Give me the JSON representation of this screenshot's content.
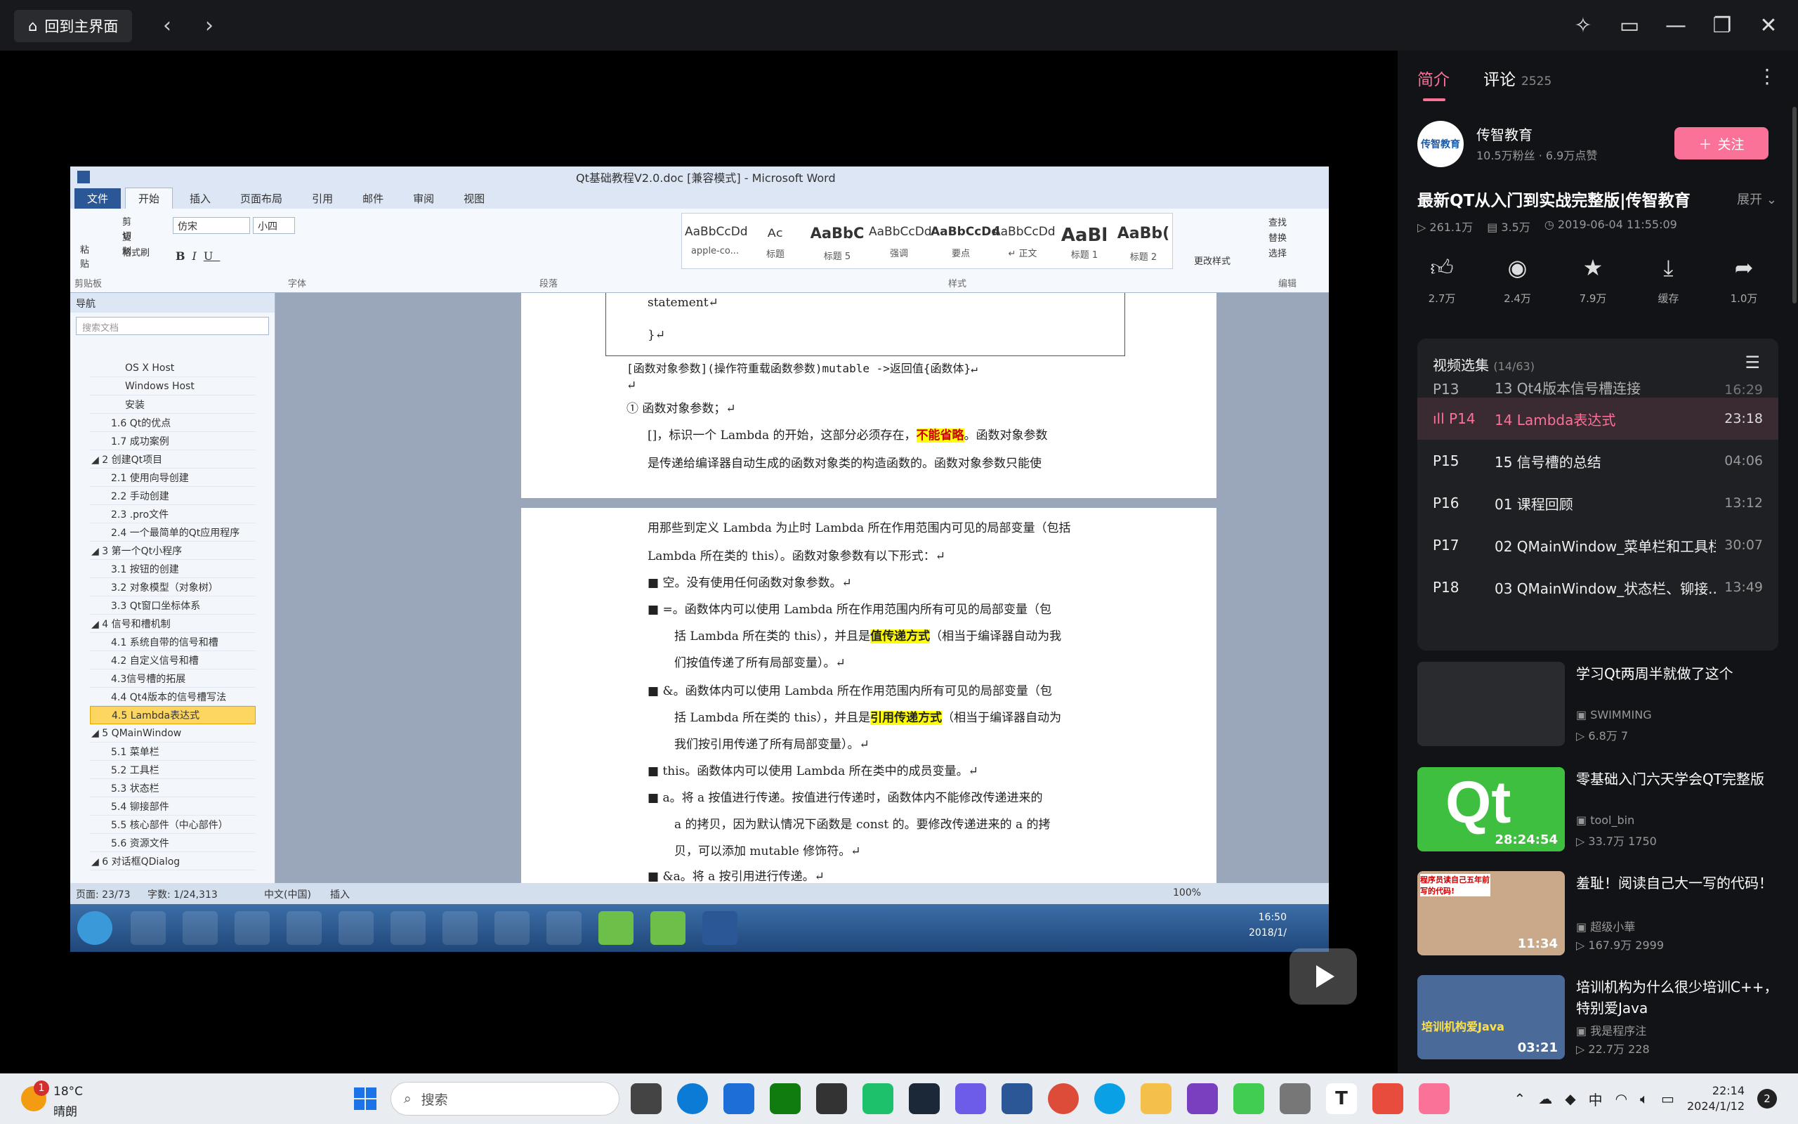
{
  "topbar": {
    "home_label": "回到主界面",
    "back_icon": "chevron-left-icon",
    "forward_icon": "chevron-right-icon"
  },
  "video": {
    "word": {
      "window_title": "Qt基础教程V2.0.doc [兼容模式] - Microsoft Word",
      "tabs": [
        "文件",
        "开始",
        "插入",
        "页面布局",
        "引用",
        "邮件",
        "审阅",
        "视图"
      ],
      "font_name": "仿宋",
      "font_size": "小四",
      "groups": [
        "剪贴板",
        "字体",
        "段落",
        "样式",
        "编辑"
      ],
      "styles": [
        {
          "sample": "AaBbCcDd",
          "label": "apple-co..."
        },
        {
          "sample": "ᴬᶜ",
          "label": "标题"
        },
        {
          "sample": "AaBbC",
          "label": "标题 5"
        },
        {
          "sample": "AaBbCcDd",
          "label": "强调"
        },
        {
          "sample": "AaBbCcDd",
          "label": "要点"
        },
        {
          "sample": "AaBbCcDd",
          "label": "↵ 正文"
        },
        {
          "sample": "AaBl",
          "label": "标题 1"
        },
        {
          "sample": "AaBb(",
          "label": "标题 2"
        }
      ],
      "change_styles": "更改样式",
      "editing": [
        "查找",
        "替换",
        "选择"
      ],
      "clipboard": [
        "剪切",
        "复制",
        "格式刷",
        "粘贴"
      ],
      "nav": {
        "title": "导航",
        "search_placeholder": "搜索文档",
        "items": [
          "OS X Host",
          "Windows Host",
          "安装",
          "1.6 Qt的优点",
          "1.7 成功案例",
          "◢ 2 创建Qt项目",
          "2.1 使用向导创建",
          "2.2 手动创建",
          "2.3 .pro文件",
          "2.4 一个最简单的Qt应用程序",
          "◢ 3 第一个Qt小程序",
          "3.1 按钮的创建",
          "3.2 对象模型（对象树）",
          "3.3 Qt窗口坐标体系",
          "◢ 4 信号和槽机制",
          "4.1 系统自带的信号和槽",
          "4.2 自定义信号和槽",
          "4.3信号槽的拓展",
          "4.4 Qt4版本的信号槽写法",
          "4.5 Lambda表达式",
          "◢ 5 QMainWindow",
          "5.1 菜单栏",
          "5.2 工具栏",
          "5.3 状态栏",
          "5.4 铆接部件",
          "5.5 核心部件（中心部件）",
          "5.6 资源文件",
          "◢ 6 对话框QDialog"
        ]
      },
      "doc": {
        "l1": "statement↵",
        "l2": "}↵",
        "l3": "[函数对象参数](操作符重载函数参数)mutable ->返回值{函数体}↵",
        "l4": "↵",
        "l5": "① 函数对象参数；↵",
        "l6a": "[]，标识一个 Lambda 的开始，这部分必须存在，",
        "l6mark": "不能省略",
        "l6b": "。函数对象参数",
        "l7": "是传递给编译器自动生成的函数对象类的构造函数的。函数对象参数只能使",
        "l8": "用那些到定义 Lambda 为止时 Lambda 所在作用范围内可见的局部变量（包括",
        "l9": "Lambda 所在类的 this）。函数对象参数有以下形式：↵",
        "b1": "■  空。没有使用任何函数对象参数。↵",
        "b2": "■  =。函数体内可以使用 Lambda 所在作用范围内所有可见的局部变量（包",
        "b2b_a": "括 Lambda 所在类的 this），并且是",
        "b2b_mark": "值传递方式",
        "b2b_b": "（相当于编译器自动为我",
        "b2c": "们按值传递了所有局部变量）。↵",
        "b3": "■  &。函数体内可以使用 Lambda 所在作用范围内所有可见的局部变量（包",
        "b3b_a": "括 Lambda 所在类的 this），并且是",
        "b3b_mark": "引用传递方式",
        "b3b_b": "（相当于编译器自动为",
        "b3c": "我们按引用传递了所有局部变量）。↵",
        "b4": "■  this。函数体内可以使用 Lambda 所在类中的成员变量。↵",
        "b5": "■  a。将 a 按值进行传递。按值进行传递时，函数体内不能修改传递进来的",
        "b5b": "a 的拷贝，因为默认情况下函数是 const 的。要修改传递进来的 a 的拷",
        "b5c": "贝，可以添加 mutable 修饰符。↵",
        "b6": "■  &a。将 a 按引用进行传递。↵"
      },
      "status": {
        "page": "页面: 23/73",
        "words": "字数: 1/24,313",
        "lang": "中文(中国)",
        "mode": "插入",
        "zoom": "100%"
      },
      "clock": "16:50",
      "date": "2018/1/"
    },
    "progress": 0.16
  },
  "right": {
    "tab_intro": "简介",
    "tab_comments": "评论",
    "comment_count": "2525",
    "uploader": {
      "name": "传智教育",
      "stats": "10.5万粉丝 · 6.9万点赞",
      "follow": "关注",
      "avatar_text": "传智教育"
    },
    "title": "最新QT从入门到实战完整版|传智教育",
    "expand": "展开",
    "meta": {
      "views": "261.1万",
      "danmaku": "3.5万",
      "date": "2019-06-04 11:55:09"
    },
    "actions": [
      {
        "icon": "thumb-up-icon",
        "value": "2.7万"
      },
      {
        "icon": "coin-icon",
        "value": "2.4万"
      },
      {
        "icon": "star-icon",
        "value": "7.9万"
      },
      {
        "icon": "download-icon",
        "value": "缓存"
      },
      {
        "icon": "share-icon",
        "value": "1.0万"
      }
    ],
    "playlist": {
      "title": "视频选集",
      "count": "(14/63)",
      "items": [
        {
          "ep": "P13",
          "name": "13 Qt4版本信号槽连接",
          "dur": "16:29"
        },
        {
          "ep": "P14",
          "name": "14 Lambda表达式",
          "dur": "23:18"
        },
        {
          "ep": "P15",
          "name": "15 信号槽的总结",
          "dur": "04:06"
        },
        {
          "ep": "P16",
          "name": "01 课程回顾",
          "dur": "13:12"
        },
        {
          "ep": "P17",
          "name": "02 QMainWindow_菜单栏和工具栏",
          "dur": "30:07"
        },
        {
          "ep": "P18",
          "name": "03 QMainWindow_状态栏、铆接...",
          "dur": "13:49"
        }
      ]
    },
    "recommend": [
      {
        "title": "学习Qt两周半就做了这个",
        "author": "SWIMMING",
        "stats": "6.8万  7",
        "dur": ""
      },
      {
        "title": "零基础入门六天学会QT完整版",
        "author": "tool_bin",
        "stats": "33.7万  1750",
        "dur": "28:24:54",
        "thumb_text": "Qt"
      },
      {
        "title": "羞耻！阅读自己大一写的代码！",
        "author": "超级小華",
        "stats": "167.9万  2999",
        "dur": "11:34",
        "thumb_text": "程序员读自己五年前写的代码!"
      },
      {
        "title": "培训机构为什么很少培训C++，特别爱Java",
        "author": "我是程序注",
        "stats": "22.7万  228",
        "dur": "03:21",
        "thumb_text": "培训机构爱Java"
      }
    ]
  },
  "taskbar": {
    "weather_temp": "18°C",
    "weather_desc": "晴朗",
    "weather_badge": "1",
    "search_label": "搜索",
    "ime": "中",
    "time": "22:14",
    "date": "2024/1/12",
    "notifications": "2"
  }
}
